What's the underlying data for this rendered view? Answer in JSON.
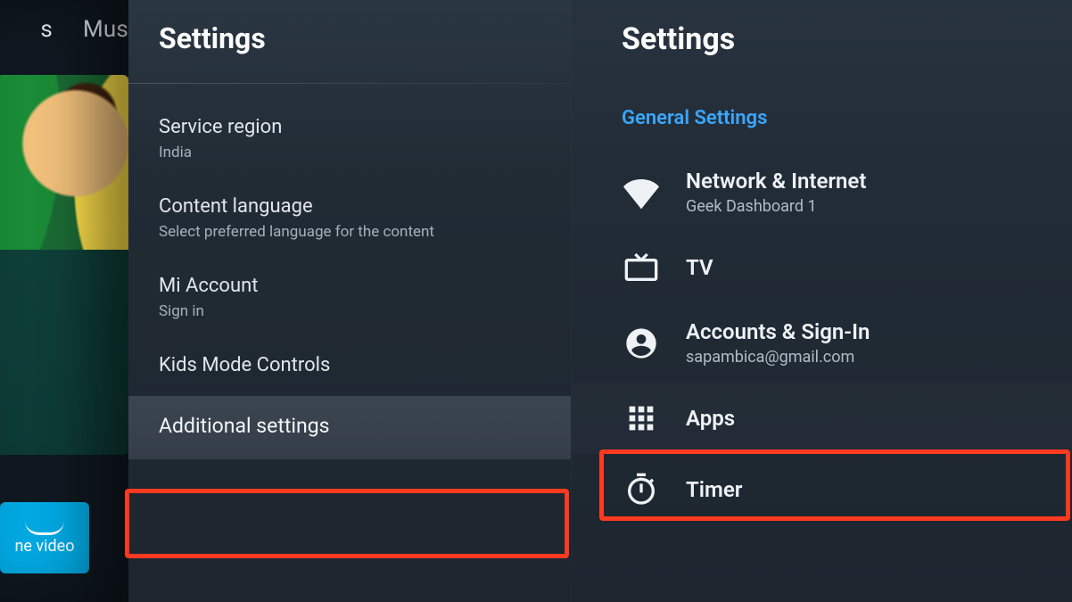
{
  "home": {
    "nav_item_cut": "s",
    "nav_item_music_cut": "Mus",
    "app_tile_label_cut": "ne video"
  },
  "left_panel": {
    "title": "Settings",
    "items": [
      {
        "title": "Service region",
        "sub": "India"
      },
      {
        "title": "Content language",
        "sub": "Select preferred language for the content"
      },
      {
        "title": "Mi Account",
        "sub": "Sign in"
      },
      {
        "title": "Kids Mode Controls",
        "sub": ""
      },
      {
        "title": "Additional settings",
        "sub": ""
      }
    ]
  },
  "right_panel": {
    "title": "Settings",
    "section": "General Settings",
    "items": [
      {
        "icon": "wifi-icon",
        "title": "Network & Internet",
        "sub": "Geek Dashboard 1"
      },
      {
        "icon": "tv-icon",
        "title": "TV",
        "sub": ""
      },
      {
        "icon": "person-icon",
        "title": "Accounts & Sign-In",
        "sub": "sapambica@gmail.com"
      },
      {
        "icon": "apps-icon",
        "title": "Apps",
        "sub": ""
      },
      {
        "icon": "timer-icon",
        "title": "Timer",
        "sub": ""
      }
    ]
  },
  "highlight_color": "#ff3a20"
}
